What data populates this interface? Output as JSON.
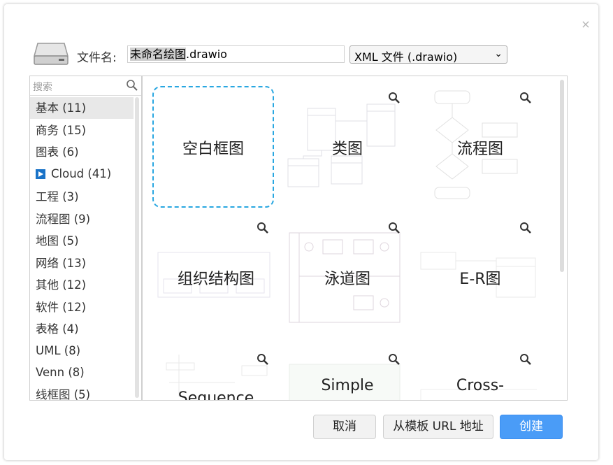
{
  "dialog": {
    "close_glyph": "×",
    "filename_label": "文件名:",
    "filename_selected": "未命名绘图",
    "filename_ext": ".drawio",
    "filetype": "XML 文件 (.drawio)"
  },
  "sidebar": {
    "search_placeholder": "搜索",
    "categories": [
      {
        "label": "基本 (11)"
      },
      {
        "label": "商务 (15)"
      },
      {
        "label": "图表 (6)"
      },
      {
        "label": "Cloud (41)"
      },
      {
        "label": "工程 (3)"
      },
      {
        "label": "流程图 (9)"
      },
      {
        "label": "地图 (5)"
      },
      {
        "label": "网络 (13)"
      },
      {
        "label": "其他 (12)"
      },
      {
        "label": "软件 (12)"
      },
      {
        "label": "表格 (4)"
      },
      {
        "label": "UML (8)"
      },
      {
        "label": "Venn (8)"
      },
      {
        "label": "线框图 (5)"
      }
    ]
  },
  "templates": [
    {
      "label": "空白框图"
    },
    {
      "label": "类图"
    },
    {
      "label": "流程图"
    },
    {
      "label": "组织结构图"
    },
    {
      "label": "泳道图"
    },
    {
      "label": "E-R图"
    },
    {
      "label": "Sequence"
    },
    {
      "label": "Simple"
    },
    {
      "label": "Cross-"
    }
  ],
  "buttons": {
    "cancel": "取消",
    "from_url": "从模板 URL 地址",
    "create": "创建"
  },
  "colors": {
    "accent": "#4a9cf7",
    "selected_border": "#29a7e1"
  }
}
